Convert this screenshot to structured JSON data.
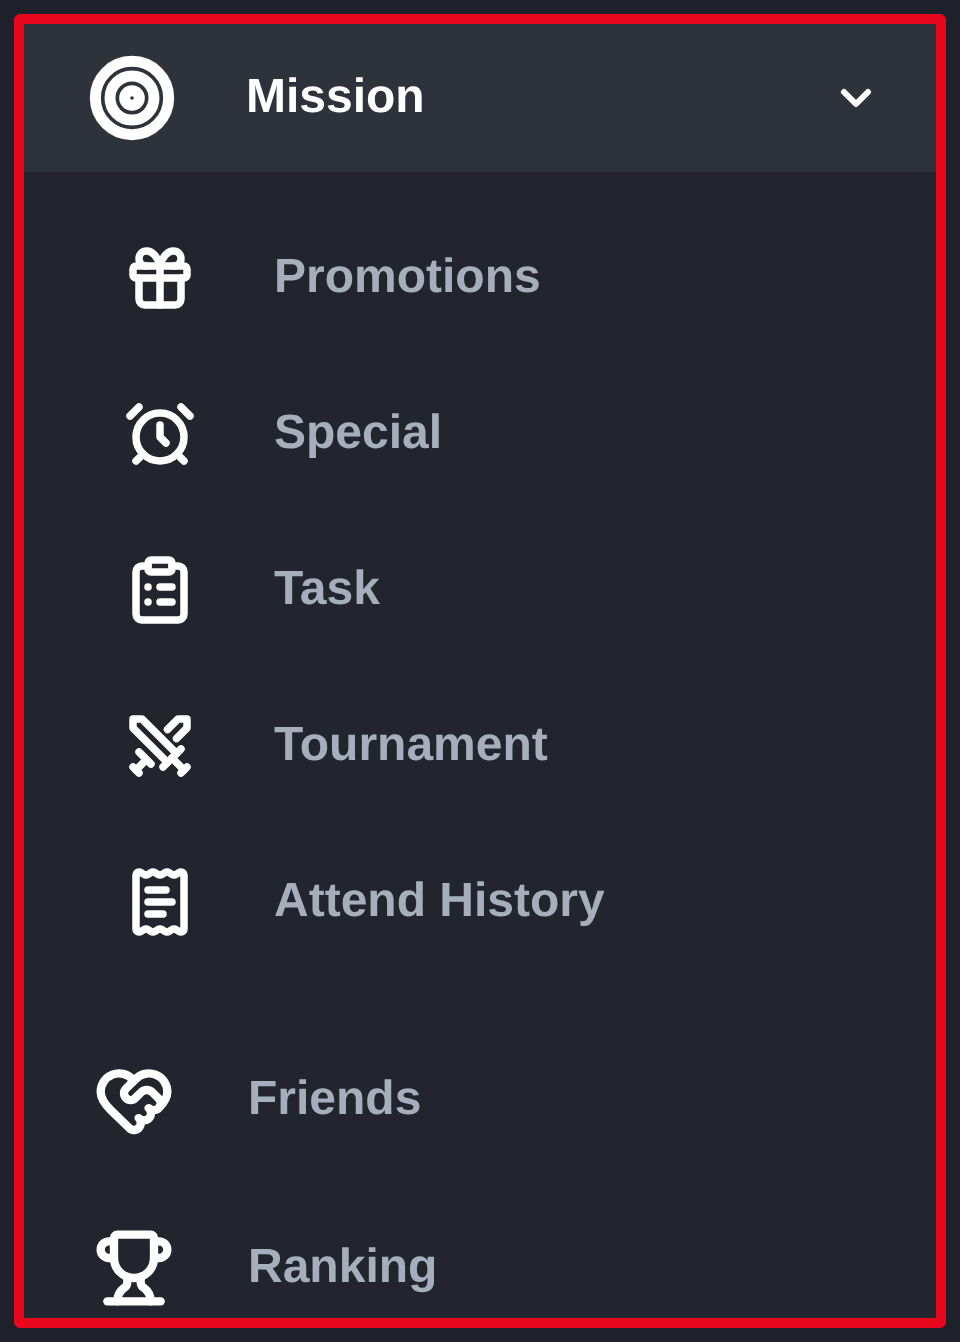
{
  "menu": {
    "label": "Mission",
    "expanded": true,
    "children": [
      {
        "label": "Promotions"
      },
      {
        "label": "Special"
      },
      {
        "label": "Task"
      },
      {
        "label": "Tournament"
      },
      {
        "label": "Attend History"
      }
    ]
  },
  "items": [
    {
      "label": "Friends"
    },
    {
      "label": "Ranking"
    }
  ]
}
